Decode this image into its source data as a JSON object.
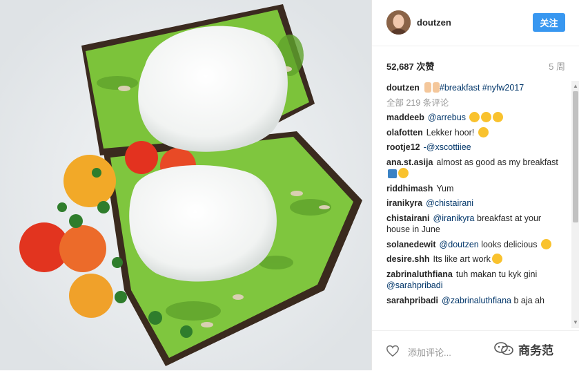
{
  "header": {
    "username": "doutzen",
    "follow_label": "关注"
  },
  "meta": {
    "likes": "52,687 次赞",
    "time": "5 周"
  },
  "caption": {
    "user": "doutzen",
    "text_pre": "",
    "hashtag1": "#breakfast",
    "hashtag2": "#nyfw2017"
  },
  "view_all": "全部 219 条评论",
  "comments": [
    {
      "user": "maddeeb",
      "mention": "@arrebus",
      "text": ""
    },
    {
      "user": "olafotten",
      "mention": "",
      "text": "Lekker hoor!"
    },
    {
      "user": "rootje12",
      "mention": "",
      "text": "-@xscottiiee"
    },
    {
      "user": "ana.st.asija",
      "mention": "",
      "text": "almost as good as my breakfast"
    },
    {
      "user": "riddhimash",
      "mention": "",
      "text": "Yum"
    },
    {
      "user": "iranikyra",
      "mention": "@chistairani",
      "text": ""
    },
    {
      "user": "chistairani",
      "mention": "@iranikyra",
      "text": "breakfast at your house in June"
    },
    {
      "user": "solanedewit",
      "mention": "@doutzen",
      "text": "looks delicious"
    },
    {
      "user": "desire.shh",
      "mention": "",
      "text": "Its like art work"
    },
    {
      "user": "zabrinaluthfiana",
      "mention": "",
      "text": "tuh makan tu kyk gini"
    },
    {
      "user": "",
      "mention": "@sarahpribadi",
      "text": ""
    },
    {
      "user": "sarahpribadi",
      "mention": "@zabrinaluthfiana",
      "text": "b aja ah"
    }
  ],
  "footer": {
    "add_comment": "添加评论...",
    "watermark": "商务范"
  },
  "icons": {
    "heart": "heart-outline-icon",
    "wechat": "wechat-icon"
  }
}
